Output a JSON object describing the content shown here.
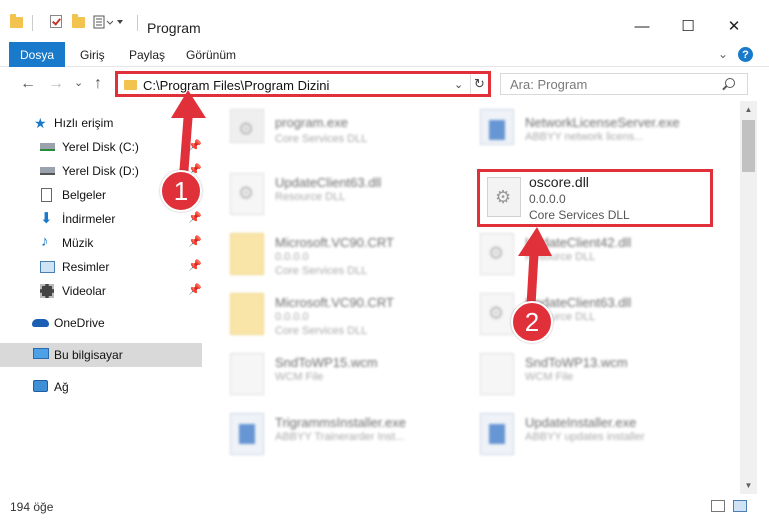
{
  "window": {
    "title": "Program",
    "minimize_glyph": "—",
    "maximize_glyph": "☐",
    "close_glyph": "✕"
  },
  "ribbon": {
    "tabs": [
      "Dosya",
      "Giriş",
      "Paylaş",
      "Görünüm"
    ],
    "active_tab": "Dosya",
    "accent_color": "#1979ca",
    "expand_glyph": "⌄",
    "help_glyph": "?"
  },
  "nav_buttons": {
    "back": "←",
    "forward": "→",
    "dropdown": "⌄",
    "up": "↑"
  },
  "address": {
    "path": "C:\\Program Files\\Program Dizini",
    "dropdown_glyph": "⌄",
    "refresh_glyph": "↻"
  },
  "search": {
    "placeholder": "Ara: Program"
  },
  "sidebar": {
    "quick_access": "Hızlı erişim",
    "items": [
      {
        "label": "Yerel Disk (C:)",
        "icon": "drive-icon",
        "pinned": true
      },
      {
        "label": "Yerel Disk (D:)",
        "icon": "drive-icon",
        "pinned": true
      },
      {
        "label": "Belgeler",
        "icon": "documents-icon",
        "pinned": true
      },
      {
        "label": "İndirmeler",
        "icon": "download-icon",
        "pinned": true
      },
      {
        "label": "Müzik",
        "icon": "music-icon",
        "pinned": true
      },
      {
        "label": "Resimler",
        "icon": "pictures-icon",
        "pinned": true
      },
      {
        "label": "Videolar",
        "icon": "videos-icon",
        "pinned": true
      }
    ],
    "onedrive": "OneDrive",
    "this_pc": "Bu bilgisayar",
    "network": "Ağ",
    "pin_glyph": "📌"
  },
  "files": {
    "left": [
      {
        "name": "program.exe",
        "version": "",
        "desc": "Core Services DLL",
        "icon": "exe-icon"
      },
      {
        "name": "UpdateClient63.dll",
        "version": "",
        "desc": "Resource DLL",
        "icon": "dll-icon"
      },
      {
        "name": "Microsoft.VC90.CRT",
        "version": "0.0.0.0",
        "desc": "Core Services DLL",
        "icon": "folder-icon"
      },
      {
        "name": "Microsoft.VC90.CRT",
        "version": "0.0.0.0",
        "desc": "Core Services DLL",
        "icon": "folder-icon"
      },
      {
        "name": "SndToWP15.wcm",
        "version": "",
        "desc": "WCM File",
        "icon": "file-icon"
      },
      {
        "name": "TrigrammsInstaller.exe",
        "version": "",
        "desc": "ABBYY Trainerarder Inst...",
        "icon": "setup-icon"
      }
    ],
    "right": [
      {
        "name": "NetworkLicenseServer.exe",
        "version": "",
        "desc": "ABBYY network licens...",
        "icon": "setup-icon"
      },
      {
        "name": "UpdateClient42.dll",
        "version": "",
        "desc": "Resource DLL",
        "icon": "dll-icon"
      },
      {
        "name": "UpdateClient63.dll",
        "version": "",
        "desc": "Resource DLL",
        "icon": "dll-icon"
      },
      {
        "name": "SndToWP13.wcm",
        "version": "",
        "desc": "WCM File",
        "icon": "file-icon"
      },
      {
        "name": "UpdateInstaller.exe",
        "version": "",
        "desc": "ABBYY updates installer",
        "icon": "setup-icon"
      }
    ]
  },
  "highlighted_file": {
    "name": "oscore.dll",
    "version": "0.0.0.0",
    "desc": "Core Services DLL",
    "icon": "dll-gear-icon"
  },
  "markers": {
    "first": "1",
    "second": "2",
    "color": "#e0313b"
  },
  "status": {
    "item_count": "194 öğe"
  },
  "scrollbar": {
    "up_glyph": "▲",
    "down_glyph": "▼"
  }
}
